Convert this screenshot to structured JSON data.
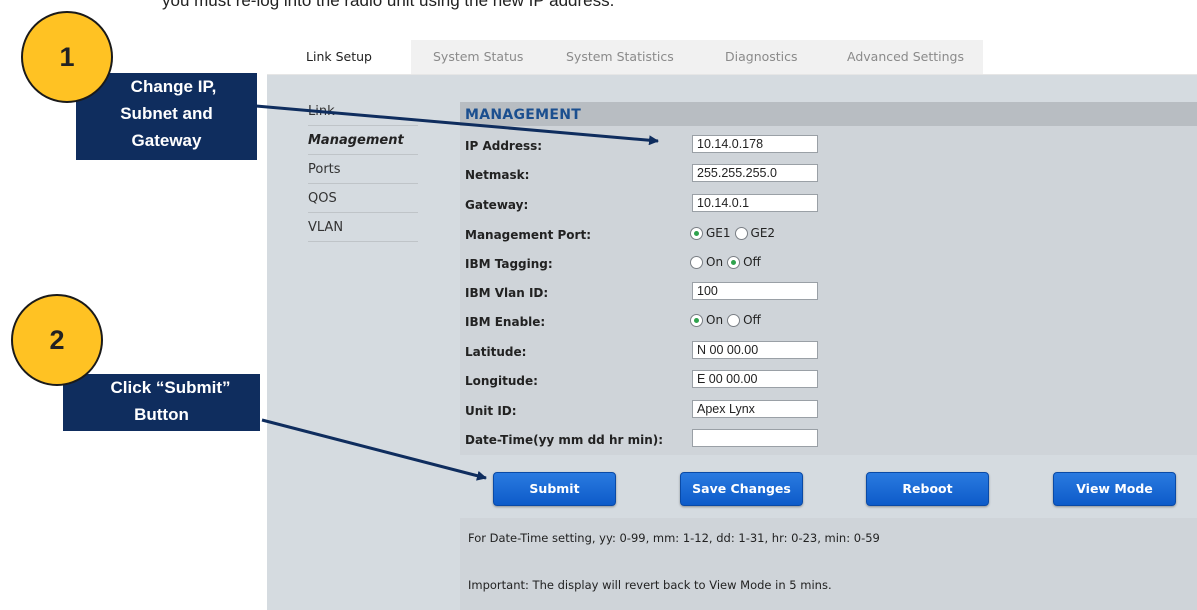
{
  "doc": {
    "top_text": "you must re-log into the radio unit using the new IP address."
  },
  "tabs": [
    {
      "label": "Link Setup",
      "active": true
    },
    {
      "label": "System Status"
    },
    {
      "label": "System Statistics"
    },
    {
      "label": "Diagnostics"
    },
    {
      "label": "Advanced Settings"
    }
  ],
  "menu": [
    {
      "label": "Link"
    },
    {
      "label": "Management",
      "active": true
    },
    {
      "label": "Ports"
    },
    {
      "label": "QOS"
    },
    {
      "label": "VLAN"
    }
  ],
  "panel": {
    "title": "MANAGEMENT",
    "fields": {
      "ip_label": "IP Address:",
      "ip_value": "10.14.0.178",
      "netmask_label": "Netmask:",
      "netmask_value": "255.255.255.0",
      "gateway_label": "Gateway:",
      "gateway_value": "10.14.0.1",
      "mgmt_port_label": "Management Port:",
      "mgmt_port_opt1": "GE1",
      "mgmt_port_opt2": "GE2",
      "mgmt_port_selected": "GE1",
      "ibm_tagging_label": "IBM Tagging:",
      "ibm_tagging_on": "On",
      "ibm_tagging_off": "Off",
      "ibm_tagging_selected": "Off",
      "ibm_vlan_label": "IBM Vlan ID:",
      "ibm_vlan_value": "100",
      "ibm_enable_label": "IBM Enable:",
      "ibm_enable_on": "On",
      "ibm_enable_off": "Off",
      "ibm_enable_selected": "On",
      "latitude_label": "Latitude:",
      "latitude_value": "N 00 00.00",
      "longitude_label": "Longitude:",
      "longitude_value": "E 00 00.00",
      "unit_id_label": "Unit ID:",
      "unit_id_value": "Apex Lynx",
      "datetime_label": "Date-Time(yy mm dd hr min):",
      "datetime_value": ""
    }
  },
  "buttons": {
    "submit": "Submit",
    "save": "Save Changes",
    "reboot": "Reboot",
    "view_mode": "View Mode"
  },
  "info": {
    "line1": "For Date-Time setting, yy: 0-99, mm: 1-12, dd: 1-31, hr: 0-23, min: 0-59",
    "line2": "Important: The display will revert back to View Mode in 5 mins."
  },
  "annotations": {
    "step1_number": "1",
    "step1_text_l1": "Change IP,",
    "step1_text_l2": "Subnet and",
    "step1_text_l3": "Gateway",
    "step2_number": "2",
    "step2_text_l1": "Click “Submit”",
    "step2_text_l2": "Button"
  },
  "colors": {
    "accent": "#0d5bc9",
    "callout_bg": "#0f2d5e",
    "badge": "#ffc223",
    "panel": "#cfd4d9",
    "heading": "#1b4f8f"
  }
}
